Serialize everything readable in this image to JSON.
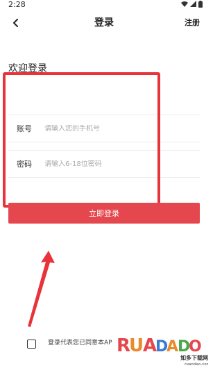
{
  "status_bar": {
    "time": "2:28",
    "icons": [
      "wifi-icon",
      "signal-icon",
      "battery-icon"
    ]
  },
  "header": {
    "title": "登录",
    "register_label": "注册",
    "back_icon": "chevron-left-icon"
  },
  "welcome_text": "欢迎登录",
  "form": {
    "account": {
      "label": "账号",
      "placeholder": "请输入您的手机号",
      "value": ""
    },
    "password": {
      "label": "密码",
      "placeholder": "请输入6-18位密码",
      "value": ""
    }
  },
  "login_button_label": "立即登录",
  "agreement": {
    "checked": false,
    "text": "登录代表您已同意本AP"
  },
  "watermark": {
    "logo_text": "RUANDADO",
    "subtext": "如多下载网",
    "url": "ruandao.com"
  },
  "colors": {
    "accent": "#e5474e",
    "highlight": "#e8333b",
    "text": "#222222"
  }
}
